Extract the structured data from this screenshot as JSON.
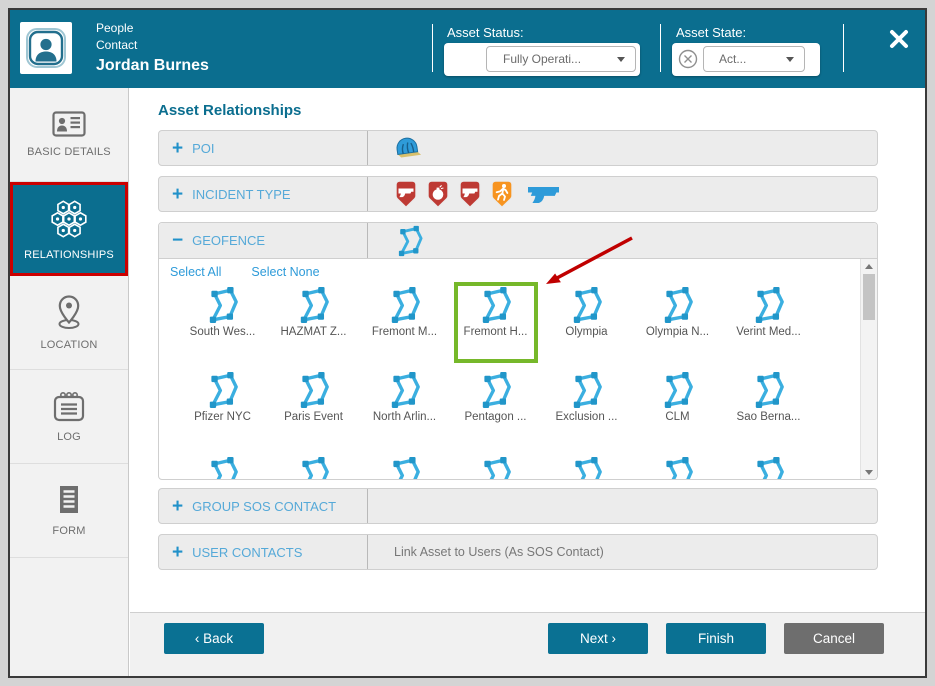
{
  "header": {
    "category": "People",
    "subcategory": "Contact",
    "person_name": "Jordan Burnes",
    "asset_status_label": "Asset Status:",
    "asset_status_value": "Fully Operati...",
    "asset_state_label": "Asset State:",
    "asset_state_value": "Act..."
  },
  "sidebar": {
    "items": [
      {
        "label": "BASIC DETAILS",
        "selected": false
      },
      {
        "label": "RELATIONSHIPS",
        "selected": true
      },
      {
        "label": "LOCATION",
        "selected": false
      },
      {
        "label": "LOG",
        "selected": false
      },
      {
        "label": "FORM",
        "selected": false
      }
    ]
  },
  "main": {
    "title": "Asset Relationships",
    "sections": {
      "poi": {
        "toggle": "+",
        "label": "POI"
      },
      "incident_type": {
        "toggle": "+",
        "label": "INCIDENT TYPE"
      },
      "geofence": {
        "toggle": "−",
        "label": "GEOFENCE"
      },
      "group_sos": {
        "toggle": "+",
        "label": "GROUP SOS CONTACT"
      },
      "user_contacts": {
        "toggle": "+",
        "label": "USER CONTACTS",
        "hint": "Link Asset to Users (As SOS Contact)"
      }
    },
    "geofence_panel": {
      "select_all": "Select All",
      "select_none": "Select None",
      "items": [
        "South Wes...",
        "HAZMAT Z...",
        "Fremont M...",
        "Fremont H...",
        "Olympia",
        "Olympia N...",
        "Verint Med...",
        "Pfizer NYC",
        "Paris Event",
        "North Arlin...",
        "Pentagon ...",
        "Exclusion ...",
        "CLM",
        "Sao Berna..."
      ],
      "highlighted_item": "Fremont H..."
    }
  },
  "footer": {
    "back": "‹ Back",
    "next": "Next ›",
    "finish": "Finish",
    "cancel": "Cancel"
  },
  "icons": {
    "incident_type_icons": [
      "gun-badge",
      "bomb-badge",
      "gun-badge",
      "runner-badge",
      "pistol"
    ],
    "poi_icon": "dome-shelter",
    "geofence_icon": "polygon-fence"
  },
  "colors": {
    "header_teal": "#0B6E8F",
    "accent_blue": "#55A9D8",
    "link_blue": "#2E9BD9",
    "selected_border_red": "#CC0000",
    "highlight_green": "#76B82A",
    "annotation_arrow_red": "#C00000",
    "incident_red": "#BE3A34",
    "incident_orange": "#F79420",
    "button_teal": "#0A7193",
    "button_gray": "#6E6E6E"
  }
}
